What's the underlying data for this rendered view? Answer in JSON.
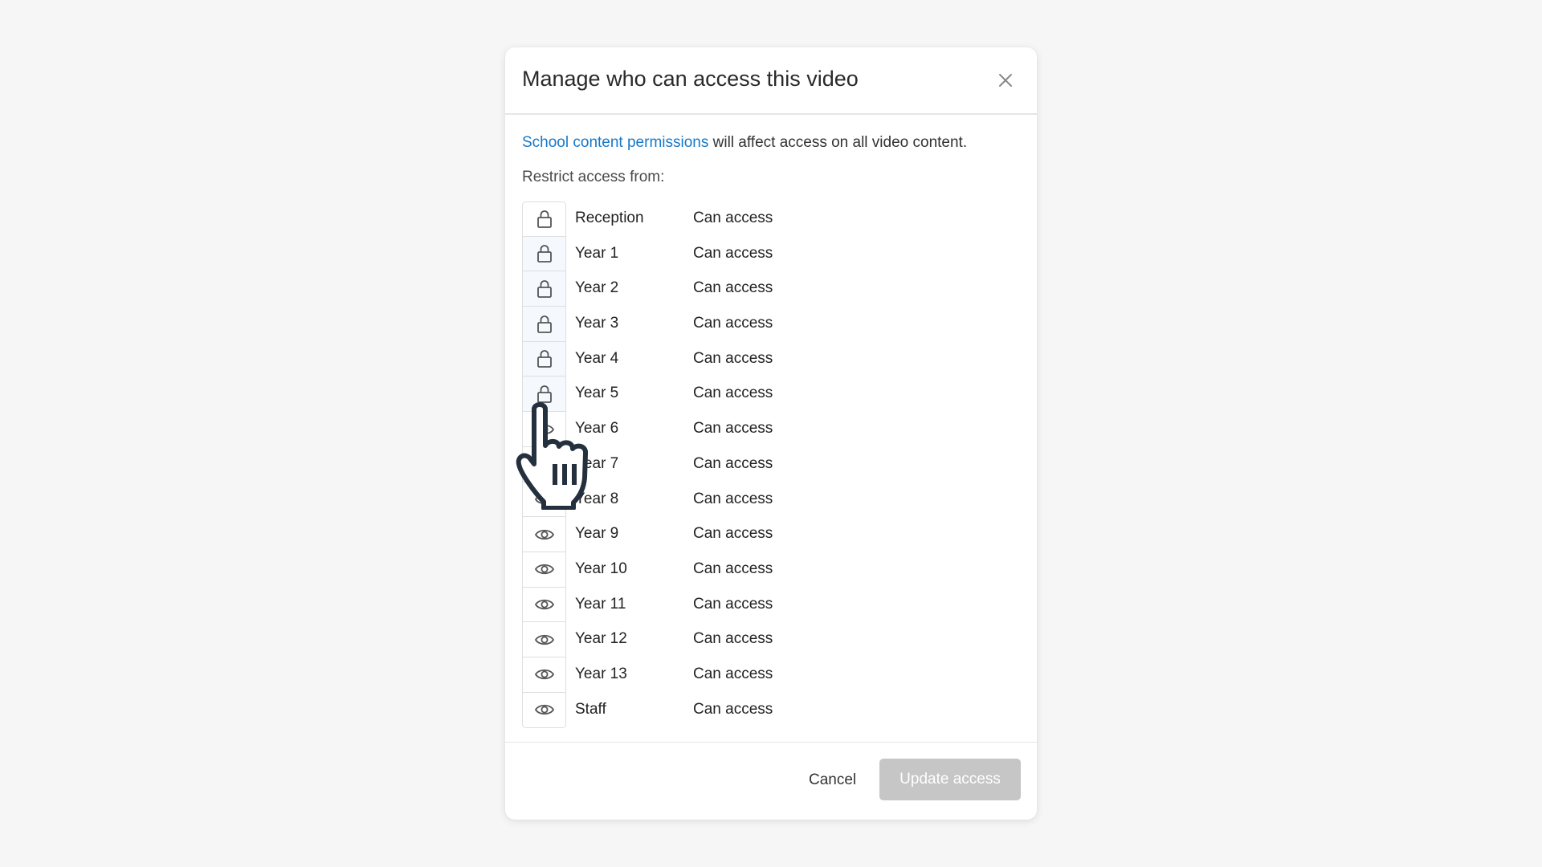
{
  "dialog": {
    "title": "Manage who can access this video",
    "close_label": "Close"
  },
  "info": {
    "link_text": "School content permissions",
    "suffix_text": " will affect access on all video content."
  },
  "restrict_label": "Restrict access from:",
  "groups": [
    {
      "name": "Reception",
      "status": "Can access",
      "icon": "lock-icon"
    },
    {
      "name": "Year 1",
      "status": "Can access",
      "icon": "lock-icon"
    },
    {
      "name": "Year 2",
      "status": "Can access",
      "icon": "lock-icon"
    },
    {
      "name": "Year 3",
      "status": "Can access",
      "icon": "lock-icon"
    },
    {
      "name": "Year 4",
      "status": "Can access",
      "icon": "lock-icon"
    },
    {
      "name": "Year 5",
      "status": "Can access",
      "icon": "lock-icon"
    },
    {
      "name": "Year 6",
      "status": "Can access",
      "icon": "eye-icon"
    },
    {
      "name": "Year 7",
      "status": "Can access",
      "icon": "eye-icon"
    },
    {
      "name": "Year 8",
      "status": "Can access",
      "icon": "eye-icon"
    },
    {
      "name": "Year 9",
      "status": "Can access",
      "icon": "eye-icon"
    },
    {
      "name": "Year 10",
      "status": "Can access",
      "icon": "eye-icon"
    },
    {
      "name": "Year 11",
      "status": "Can access",
      "icon": "eye-icon"
    },
    {
      "name": "Year 12",
      "status": "Can access",
      "icon": "eye-icon"
    },
    {
      "name": "Year 13",
      "status": "Can access",
      "icon": "eye-icon"
    },
    {
      "name": "Staff",
      "status": "Can access",
      "icon": "eye-icon"
    }
  ],
  "footer": {
    "cancel_label": "Cancel",
    "update_label": "Update access"
  },
  "colors": {
    "link": "#1879c9",
    "disabled_button": "#c6c6c6",
    "locked_row_bg": "#f5f9fd"
  }
}
